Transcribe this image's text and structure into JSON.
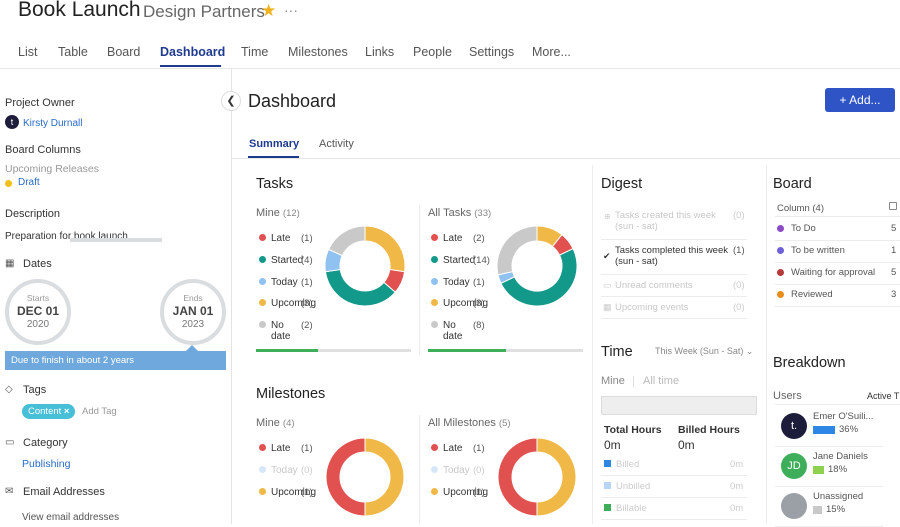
{
  "header": {
    "title": "Book Launch",
    "subtitle": "Design Partners",
    "star_icon": "star-icon",
    "more_icon": "more-dots-icon"
  },
  "tabs": [
    {
      "label": "List"
    },
    {
      "label": "Table"
    },
    {
      "label": "Board"
    },
    {
      "label": "Dashboard"
    },
    {
      "label": "Time"
    },
    {
      "label": "Milestones"
    },
    {
      "label": "Links"
    },
    {
      "label": "People"
    },
    {
      "label": "Settings"
    },
    {
      "label": "More..."
    }
  ],
  "sidebar": {
    "owner_label": "Project Owner",
    "owner_initial": "t",
    "owner_name": "Kirsty Durnall",
    "board_columns_label": "Board Columns",
    "board_group": "Upcoming Releases",
    "board_status": "Draft",
    "description_label": "Description",
    "description": "Preparation for book launch",
    "dates_label": "Dates",
    "start_label": "Starts",
    "start_date": "DEC 01",
    "start_year": "2020",
    "end_label": "Ends",
    "end_date": "JAN 01",
    "end_year": "2023",
    "due_text": "Due to finish in about 2 years",
    "tags_label": "Tags",
    "tag": "Content",
    "tag_remove": "×",
    "add_tag": "Add Tag",
    "category_label": "Category",
    "category": "Publishing",
    "email_label": "Email Addresses",
    "view_email": "View email addresses"
  },
  "main": {
    "collapse_icon": "chevron-left-icon",
    "title": "Dashboard",
    "add_button": "Add...",
    "subtabs": [
      {
        "label": "Summary"
      },
      {
        "label": "Activity"
      }
    ]
  },
  "tasks": {
    "title": "Tasks",
    "mine": {
      "label": "Mine",
      "count": "(12)",
      "legend": [
        {
          "label": "Late",
          "value": "(1)"
        },
        {
          "label": "Started",
          "value": "(4)"
        },
        {
          "label": "Today",
          "value": "(1)"
        },
        {
          "label": "Upcoming",
          "value": "(3)"
        },
        {
          "label": "No date",
          "value": "(2)"
        }
      ],
      "progress": 0.4
    },
    "all": {
      "label": "All Tasks",
      "count": "(33)",
      "legend": [
        {
          "label": "Late",
          "value": "(2)"
        },
        {
          "label": "Started",
          "value": "(14)"
        },
        {
          "label": "Today",
          "value": "(1)"
        },
        {
          "label": "Upcoming",
          "value": "(3)"
        },
        {
          "label": "No date",
          "value": "(8)"
        }
      ],
      "progress": 0.5
    }
  },
  "milestones": {
    "title": "Milestones",
    "mine": {
      "label": "Mine",
      "count": "(4)",
      "legend": [
        {
          "label": "Late",
          "value": "(1)"
        },
        {
          "label": "Today",
          "value": "(0)"
        },
        {
          "label": "Upcoming",
          "value": "(1)"
        }
      ]
    },
    "all": {
      "label": "All Milestones",
      "count": "(5)",
      "legend": [
        {
          "label": "Late",
          "value": "(1)"
        },
        {
          "label": "Today",
          "value": "(0)"
        },
        {
          "label": "Upcoming",
          "value": "(1)"
        }
      ]
    }
  },
  "digest": {
    "title": "Digest",
    "rows": [
      {
        "label": "Tasks created this week (sun - sat)",
        "value": "(0)"
      },
      {
        "label": "Tasks completed this week (sun - sat)",
        "value": "(1)"
      },
      {
        "label": "Unread comments",
        "value": "(0)"
      },
      {
        "label": "Upcoming events",
        "value": "(0)"
      }
    ]
  },
  "time": {
    "title": "Time",
    "range": "This Week (Sun - Sat)",
    "filter_mine": "Mine",
    "filter_all": "All time",
    "total_label": "Total Hours",
    "total_value": "0m",
    "billed_label": "Billed Hours",
    "billed_value": "0m",
    "legend": [
      {
        "label": "Billed",
        "value": "0m"
      },
      {
        "label": "Unbilled",
        "value": "0m"
      },
      {
        "label": "Billable",
        "value": "0m"
      }
    ]
  },
  "board": {
    "title": "Board",
    "column_label": "Column (4)",
    "rows": [
      {
        "label": "To Do",
        "value": "5"
      },
      {
        "label": "To be written",
        "value": "1"
      },
      {
        "label": "Waiting for approval",
        "value": "5"
      },
      {
        "label": "Reviewed",
        "value": "3"
      }
    ]
  },
  "breakdown": {
    "title": "Breakdown",
    "users_label": "Users",
    "active_label": "Active T",
    "users": [
      {
        "name": "Emer O'Suili...",
        "initials": "t.",
        "pct": "36%",
        "value": 36
      },
      {
        "name": "Jane Daniels",
        "initials": "JD",
        "pct": "18%",
        "value": 18
      },
      {
        "name": "Unassigned",
        "initials": "",
        "pct": "15%",
        "value": 15
      }
    ]
  },
  "colors": {
    "late": "#e0514f",
    "started": "#13998a",
    "today": "#8fc2f0",
    "upcoming": "#f0b847",
    "nodate": "#c9c9c9",
    "accent": "#2f54c6",
    "progress": "#3fae5a"
  },
  "chart_data": [
    {
      "type": "pie",
      "title": "Mine",
      "categories": [
        "Late",
        "Started",
        "Today",
        "Upcoming",
        "No date"
      ],
      "values": [
        1,
        4,
        1,
        3,
        2
      ]
    },
    {
      "type": "pie",
      "title": "All Tasks",
      "categories": [
        "Late",
        "Started",
        "Today",
        "Upcoming",
        "No date"
      ],
      "values": [
        2,
        14,
        1,
        3,
        8
      ]
    },
    {
      "type": "pie",
      "title": "Mine",
      "categories": [
        "Late",
        "Upcoming"
      ],
      "values": [
        1,
        1
      ]
    },
    {
      "type": "pie",
      "title": "All Milestones",
      "categories": [
        "Late",
        "Upcoming"
      ],
      "values": [
        1,
        1
      ]
    }
  ]
}
